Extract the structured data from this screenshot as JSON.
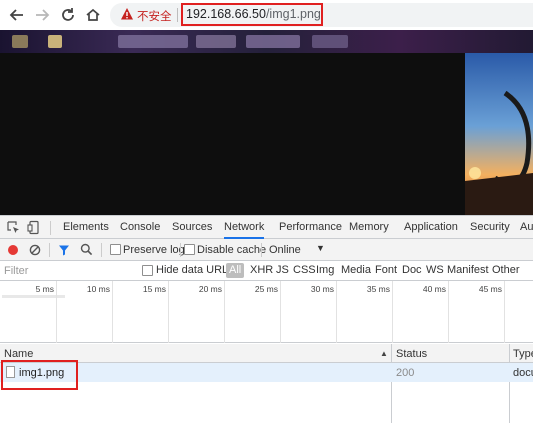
{
  "browser": {
    "back_icon": "arrow-left-icon",
    "forward_icon": "arrow-right-icon",
    "reload_icon": "reload-icon",
    "home_icon": "home-icon",
    "security_icon": "warning-triangle-icon",
    "security_label": "不安全",
    "url_host": "192.168.66.50",
    "url_path": "/img1.png"
  },
  "devtools": {
    "tabs": [
      "Elements",
      "Console",
      "Sources",
      "Network",
      "Performance",
      "Memory",
      "Application",
      "Security",
      "Au"
    ],
    "active_tab": "Network",
    "controls": {
      "record_icon": "record-icon",
      "clear_icon": "clear-icon",
      "filter_icon": "filter-icon",
      "search_icon": "search-icon",
      "preserve_log": "Preserve log",
      "disable_cache": "Disable cache",
      "throttle": "Online"
    },
    "filter": {
      "placeholder": "Filter",
      "hide_data_urls": "Hide data URLs",
      "types": [
        "All",
        "XHR",
        "JS",
        "CSS",
        "Img",
        "Media",
        "Font",
        "Doc",
        "WS",
        "Manifest",
        "Other"
      ]
    },
    "timeline": {
      "ticks": [
        "5 ms",
        "10 ms",
        "15 ms",
        "20 ms",
        "25 ms",
        "30 ms",
        "35 ms",
        "40 ms",
        "45 ms"
      ]
    },
    "table": {
      "columns": [
        "Name",
        "Status",
        "Type"
      ],
      "rows": [
        {
          "name": "img1.png",
          "status": "200",
          "type": "docu"
        }
      ]
    }
  },
  "colors": {
    "insecure_red": "#c5221f",
    "highlight_red": "#e02020",
    "active_tab_blue": "#1a73e8",
    "record_red": "#e53935",
    "selected_row": "#e4f0fc"
  }
}
